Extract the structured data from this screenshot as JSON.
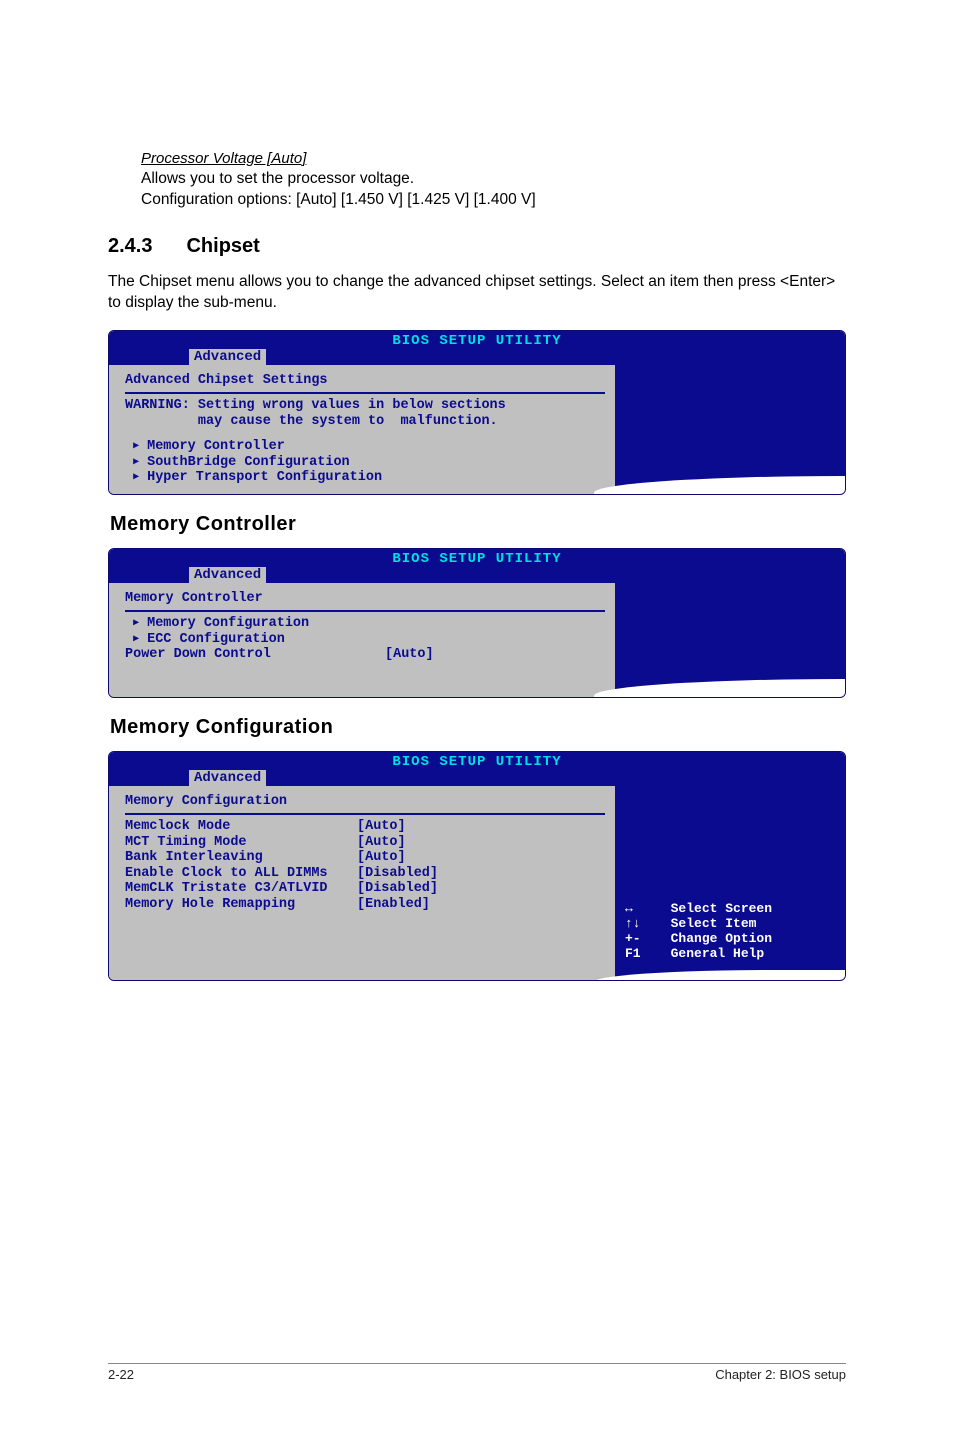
{
  "processor_voltage": {
    "heading": "Processor Voltage [Auto]",
    "line1": "Allows you to set the processor voltage.",
    "line2": "Configuration options: [Auto] [1.450 V] [1.425 V] [1.400 V]"
  },
  "section": {
    "num": "2.4.3",
    "title": "Chipset",
    "body": "The Chipset menu allows you to change the advanced chipset settings. Select an item then press <Enter> to display the sub-menu."
  },
  "bios_title": "BIOS SETUP UTILITY",
  "bios_tab": "Advanced",
  "chipset_panel": {
    "header": "Advanced Chipset Settings",
    "warning_l1": "WARNING: Setting wrong values in below sections",
    "warning_l2": "         may cause the system to  malfunction.",
    "items": [
      "Memory Controller",
      "SouthBridge Configuration",
      "Hyper Transport Configuration"
    ]
  },
  "memctrl_heading": "Memory Controller",
  "memctrl_panel": {
    "header": "Memory Controller",
    "items": [
      "Memory Configuration",
      "ECC Configuration"
    ],
    "row_label": "Power Down Control",
    "row_value": "[Auto]"
  },
  "memcfg_heading": "Memory Configuration",
  "memcfg_panel": {
    "header": "Memory Configuration",
    "rows": [
      {
        "label": "Memclock Mode",
        "value": "[Auto]"
      },
      {
        "label": "MCT Timing Mode",
        "value": "[Auto]"
      },
      {
        "label": "Bank Interleaving",
        "value": "[Auto]"
      },
      {
        "label": "Enable Clock to ALL DIMMs",
        "value": "[Disabled]"
      },
      {
        "label": "MemCLK Tristate C3/ATLVID",
        "value": "[Disabled]"
      },
      {
        "label": "Memory Hole Remapping",
        "value": "[Enabled]"
      }
    ]
  },
  "help": {
    "k1": "↔",
    "d1": "Select Screen",
    "k2": "↑↓",
    "d2": "Select Item",
    "k3": "+-",
    "d3": "Change Option",
    "k4": "F1",
    "d4": "General Help"
  },
  "footer": {
    "left": "2-22",
    "right": "Chapter 2: BIOS setup"
  }
}
